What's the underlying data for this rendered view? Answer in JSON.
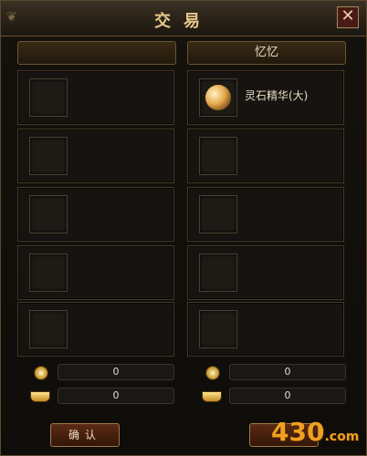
{
  "window": {
    "title": "交易",
    "close_label": "✕"
  },
  "left": {
    "header": "",
    "slots": [
      {
        "item": ""
      },
      {
        "item": ""
      },
      {
        "item": ""
      },
      {
        "item": ""
      },
      {
        "item": ""
      }
    ],
    "coin_amount": "0",
    "ingot_amount": "0"
  },
  "right": {
    "header": "忆忆",
    "slots": [
      {
        "item": "灵石精华(大)"
      },
      {
        "item": ""
      },
      {
        "item": ""
      },
      {
        "item": ""
      },
      {
        "item": ""
      }
    ],
    "coin_amount": "0",
    "ingot_amount": "0"
  },
  "buttons": {
    "confirm_label": "确认"
  },
  "watermark": {
    "main": "430",
    "suffix": ".com"
  },
  "colors": {
    "accent": "#e8c88a",
    "partner_name": "#3bb3a6"
  }
}
